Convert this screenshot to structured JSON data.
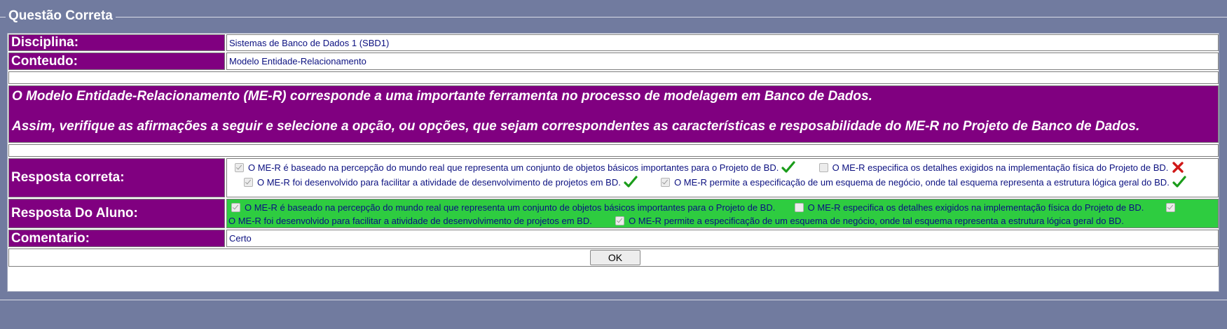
{
  "fieldset": {
    "legend": "Questão Correta"
  },
  "disciplina": {
    "label": "Disciplina:",
    "value": "Sistemas de Banco de Dados 1 (SBD1)"
  },
  "conteudo": {
    "label": "Conteudo:",
    "value": "Modelo Entidade-Relacionamento"
  },
  "question": {
    "paragraph1": "O Modelo Entidade-Relacionamento (ME-R) corresponde a uma importante ferramenta no processo de modelagem em Banco de Dados.",
    "paragraph2": "Assim, verifique as afirmações a seguir e selecione a opção, ou opções, que sejam correspondentes as características e resposabilidade do ME-R no Projeto de Banco de Dados."
  },
  "resposta_correta": {
    "label": "Resposta correta:",
    "options": [
      {
        "text": "O ME-R é baseado na percepção do mundo real que representa um conjunto de objetos básicos importantes para o Projeto de BD.",
        "checked": true,
        "mark": "check-icon"
      },
      {
        "text": "O ME-R especifica os detalhes exigidos na implementação física do Projeto de BD.",
        "checked": false,
        "mark": "cross-icon"
      },
      {
        "text": "O ME-R foi desenvolvido para facilitar a atividade de desenvolvimento de projetos em BD.",
        "checked": true,
        "mark": "check-icon"
      },
      {
        "text": "O ME-R permite a especificação de um esquema de negócio, onde tal esquema representa a estrutura lógica geral do BD.",
        "checked": true,
        "mark": "check-icon"
      }
    ]
  },
  "resposta_aluno": {
    "label": "Resposta Do Aluno:",
    "options": [
      {
        "text": "O ME-R é baseado na percepção do mundo real que representa um conjunto de objetos básicos importantes para o Projeto de BD.",
        "checked": true
      },
      {
        "text": "O ME-R especifica os detalhes exigidos na implementação física do Projeto de BD.",
        "checked": false
      },
      {
        "text": "O ME-R foi desenvolvido para facilitar a atividade de desenvolvimento de projetos em BD.",
        "checked": true
      },
      {
        "text": "O ME-R permite a especificação de um esquema de negócio, onde tal esquema representa a estrutura lógica geral do BD.",
        "checked": true
      }
    ],
    "background": "#2ecc40"
  },
  "comentario": {
    "label": "Comentario:",
    "value": "Certo"
  },
  "ok_button": {
    "label": "OK"
  },
  "colors": {
    "page_bg": "#717b9f",
    "label_bg": "#800080",
    "value_text": "#0b1080",
    "check": "#1a9c1a",
    "cross": "#d01818"
  }
}
